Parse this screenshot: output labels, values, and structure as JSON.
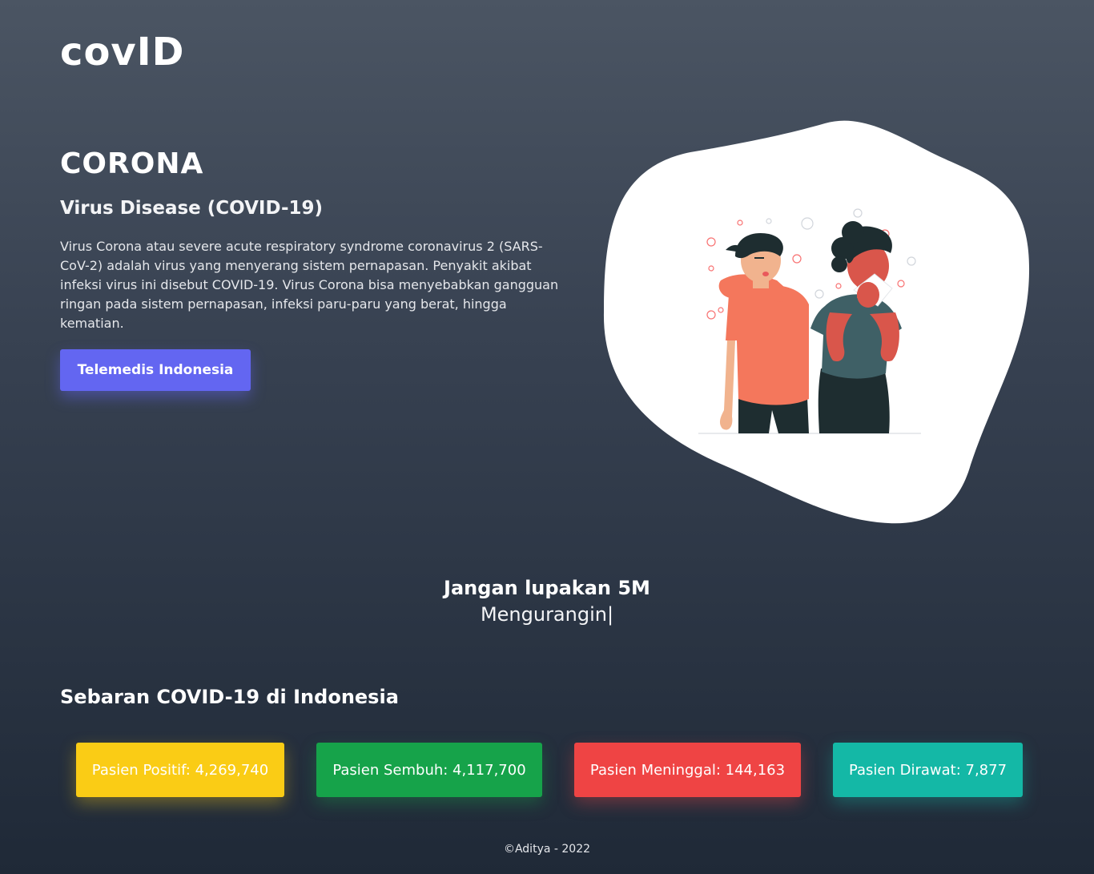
{
  "brand": {
    "logo": "covID"
  },
  "hero": {
    "title": "CORONA",
    "subtitle": "Virus Disease (COVID-19)",
    "description": "Virus Corona atau severe acute respiratory syndrome coronavirus 2 (SARS-CoV-2) adalah virus yang menyerang sistem pernapasan. Penyakit akibat infeksi virus ini disebut COVID-19. Virus Corona bisa menyebabkan gangguan ringan pada sistem pernapasan, infeksi paru-paru yang berat, hingga kematian.",
    "button_label": "Telemedis Indonesia",
    "button_color": "#6366f1"
  },
  "reminder": {
    "title": "Jangan lupakan 5M",
    "typing_text": "Mengurangin|"
  },
  "stats": {
    "section_title": "Sebaran COVID-19 di Indonesia",
    "positif": {
      "label": "Pasien Positif: 4,269,740",
      "color": "#facc15"
    },
    "sembuh": {
      "label": "Pasien Sembuh: 4,117,700",
      "color": "#16a34a"
    },
    "meninggal": {
      "label": "Pasien Meninggal: 144,163",
      "color": "#ef4444"
    },
    "dirawat": {
      "label": "Pasien Dirawat: 7,877",
      "color": "#14b8a6"
    }
  },
  "footer": {
    "text": "©Aditya - 2022"
  },
  "icons": {
    "illustration": "coughing-sneezing-people-illustration"
  }
}
